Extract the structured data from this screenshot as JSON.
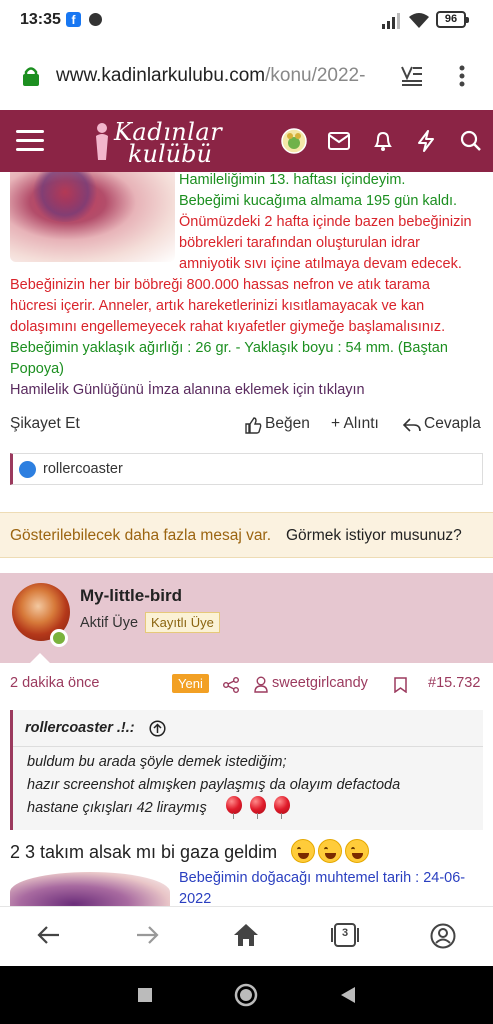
{
  "status_bar": {
    "time": "13:35",
    "battery": "96"
  },
  "browser": {
    "url_domain": "www.kadinlarkulubu.com",
    "url_path": "/konu/2022-",
    "tab_count": "3"
  },
  "site": {
    "logo_line1": "Kadınlar",
    "logo_line2": "kulübü",
    "brand_color": "#8b2445"
  },
  "post1": {
    "signature_lines": [
      {
        "text": "Hamileliğimin 13. haftası içindeyim.",
        "color": "green"
      },
      {
        "text": "Bebeğimi kucağıma almama 195 gün kaldı.",
        "color": "green"
      },
      {
        "text": "Önümüzdeki 2 hafta içinde bazen bebeğinizin",
        "color": "red"
      },
      {
        "text": "böbrekleri tarafından oluşturulan idrar",
        "color": "red"
      },
      {
        "text": "amniyotik sıvı içine atılmaya devam edecek.",
        "color": "red"
      },
      {
        "text": "Bebeğinizin her bir böbreği 800.000 hassas nefron ve atık tarama",
        "color": "red"
      },
      {
        "text": "hücresi içerir. Anneler, artık hareketlerinizi kısıtlamayacak ve kan",
        "color": "red"
      },
      {
        "text": "dolaşımını engellemeyecek rahat kıyafetler giymeğe başlamalısınız.",
        "color": "red"
      },
      {
        "text": "Bebeğimin yaklaşık ağırlığı : 26 gr. - Yaklaşık boyu : 54 mm. (Baştan",
        "color": "green"
      },
      {
        "text": "Popoya)",
        "color": "green"
      },
      {
        "text": "Hamilelik Günlüğünü İmza alanına eklemek için tıklayın",
        "color": "purple"
      }
    ],
    "report_label": "Şikayet Et",
    "like_label": "Beğen",
    "quote_label": "+ Alıntı",
    "reply_label": "Cevapla",
    "reaction_user": "rollercoaster"
  },
  "notice": {
    "text": "Gösterilebilecek daha fazla mesaj var.",
    "link": "Görmek istiyor musunuz?"
  },
  "post2": {
    "username": "My-little-bird",
    "user_title": "Aktif Üye",
    "user_badge": "Kayıtlı Üye",
    "time_ago": "2 dakika önce",
    "new_badge": "Yeni",
    "mentioned_user": "sweetgirlcandy",
    "post_number": "#15.732",
    "quote_author": "rollercoaster .!.:",
    "quote_lines": [
      "buldum bu arada şöyle demek istediğim;",
      "hazır screenshot almışken paylaşmış da olayım defactoda",
      "hastane çıkışları 42 liraymış"
    ],
    "message": "2 3 takım alsak mı bi gaza geldim",
    "signature_line1": "Bebeğimin doğacağı muhtemel tarih : 24-06-",
    "signature_line2": "2022"
  }
}
